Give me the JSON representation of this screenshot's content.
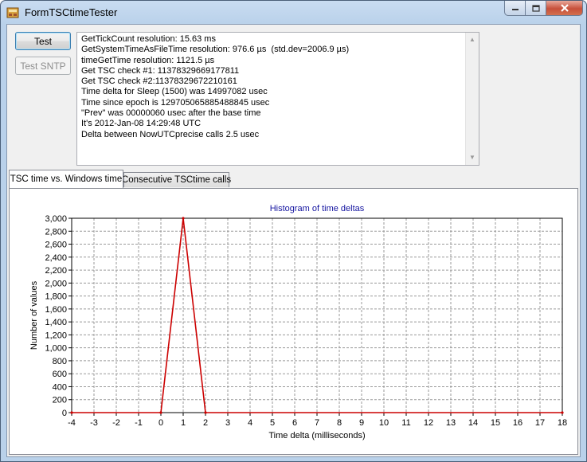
{
  "window": {
    "title": "FormTSCtimeTester"
  },
  "buttons": {
    "test": "Test",
    "test_sntp": "Test SNTP"
  },
  "log_lines": [
    "GetTickCount resolution: 15.63 ms",
    "GetSystemTimeAsFileTime resolution: 976.6 µs  (std.dev=2006.9 µs)",
    "timeGetTime resolution: 1121.5 µs",
    "Get TSC check #1: 11378329669177811",
    "Get TSC check #2:11378329672210161",
    "Time delta for Sleep (1500) was 14997082 usec",
    "Time since epoch is 129705065885488845 usec",
    "\"Prev\" was 00000060 usec after the base time",
    "It's 2012-Jan-08 14:29:48 UTC",
    "Delta between NowUTCprecise calls 2.5 usec"
  ],
  "tabs": [
    {
      "label": "TSC time vs. Windows time"
    },
    {
      "label": "Consecutive TSCtime calls"
    }
  ],
  "colors": {
    "series": "#cc0000",
    "title": "#1414a0"
  },
  "chart_data": {
    "type": "line",
    "title": "Histogram of time deltas",
    "xlabel": "Time delta (milliseconds)",
    "ylabel": "Number of values",
    "xlim": [
      -4,
      18
    ],
    "ylim": [
      0,
      3000
    ],
    "x_ticks": [
      "-4",
      "-3",
      "-2",
      "-1",
      "0",
      "1",
      "2",
      "3",
      "4",
      "5",
      "6",
      "7",
      "8",
      "9",
      "10",
      "11",
      "12",
      "13",
      "14",
      "15",
      "16",
      "17",
      "18"
    ],
    "y_ticks": [
      "0",
      "200",
      "400",
      "600",
      "800",
      "1,000",
      "1,200",
      "1,400",
      "1,600",
      "1,800",
      "2,000",
      "2,200",
      "2,400",
      "2,600",
      "2,800",
      "3,000"
    ],
    "grid": true,
    "series": [
      {
        "x": [
          -4,
          0,
          1,
          2,
          18
        ],
        "y": [
          0,
          0,
          3000,
          0,
          0
        ]
      }
    ]
  }
}
